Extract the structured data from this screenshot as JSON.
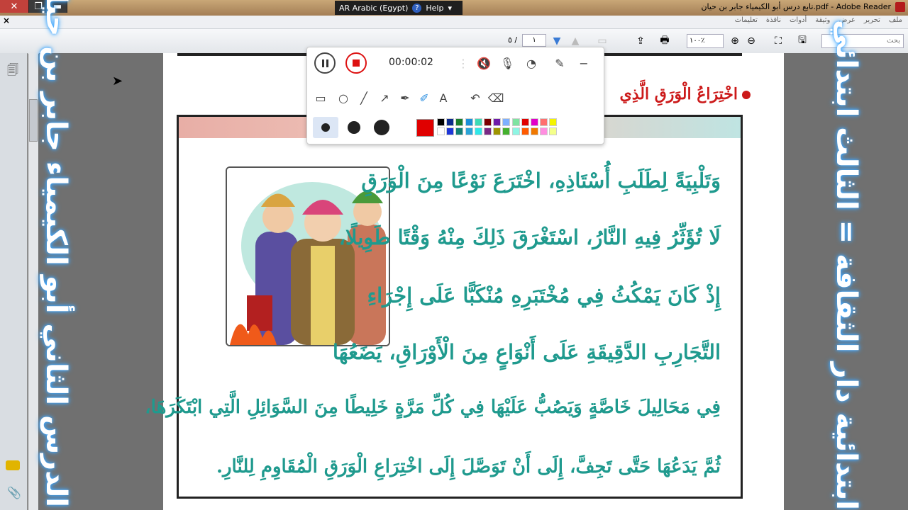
{
  "window": {
    "title": "تابع درس أبو الكيمياء جابر بن حيان.pdf - Adobe Reader",
    "close_glyph": "✕",
    "restore_glyph": "❐",
    "minimize_glyph": "▬"
  },
  "language_bar": {
    "language": "AR Arabic (Egypt)",
    "help_icon": "?",
    "help_label": "Help"
  },
  "menu": {
    "close_glyph": "×",
    "items": [
      "ملف",
      "تحرير",
      "عرض",
      "وثيقة",
      "أدوات",
      "نافذة",
      "تعليمات"
    ]
  },
  "toolbar": {
    "search_placeholder": "بحث",
    "zoom_value": "١٠٠٪",
    "current_page": "١",
    "page_total": "٥ /"
  },
  "recorder": {
    "time": "00:00:02",
    "current_color": "#e00000",
    "palette_row1": [
      "#000000",
      "#0b2a8c",
      "#1a7d2c",
      "#1b8fd8",
      "#3ddbb6",
      "#7c0000",
      "#6e1ca8",
      "#7eb0ff",
      "#7fe3a1",
      "#e00000",
      "#e100c8",
      "#ff6f6f",
      "#f4f400"
    ],
    "palette_row2": [
      "#ffffff",
      "#1d35d8",
      "#118077",
      "#2aa4d8",
      "#2ee8e8",
      "#7a2a85",
      "#9e9400",
      "#44b02e",
      "#8ef5e3",
      "#ff5a00",
      "#f07800",
      "#ff8ee0",
      "#f4ff8a"
    ]
  },
  "side_text": {
    "left": "الدرس الثاني أبو الكيمياء جابر بن حيان",
    "right": "ابتدائية دار الثقافة = الثالث ابتدائي"
  },
  "page": {
    "heading": "اخْتِرَاعُ الْوَرَقِ الَّذِي",
    "lines": [
      "وَتَلْبِيَةً لِطَلَبِ أُسْتَاذِهِ، اخْتَرَعَ نَوْعًا مِنَ الْوَرَقِ",
      "لَا تُؤَثِّرُ فِيهِ النَّارُ، اسْتَغْرَقَ ذَلِكَ مِنْهُ وَقْتًا طَوِيلًا،",
      "إِذْ كَانَ يَمْكُثُ فِي مُخْتَبَرِهِ مُنْكَبًّا عَلَى إِجْرَاءِ",
      "التَّجَارِبِ الدَّقِيقَةِ عَلَى أَنْوَاعٍ مِنَ الْأَوْرَاقِ، يَضَعُهَا",
      "فِي مَحَالِيلَ خَاصَّةٍ وَيَصُبُّ عَلَيْهَا فِي كُلِّ مَرَّةٍ خَلِيطًا مِنَ السَّوَائِلِ الَّتِي ابْتَكَرَهَا،",
      "ثُمَّ يَدَعُهَا حَتَّى تَجِفَّ، إِلَى أَنْ تَوَصَّلَ إِلَى اخْتِرَاعِ الْوَرَقِ الْمُقَاوِمِ لِلنَّارِ."
    ]
  }
}
